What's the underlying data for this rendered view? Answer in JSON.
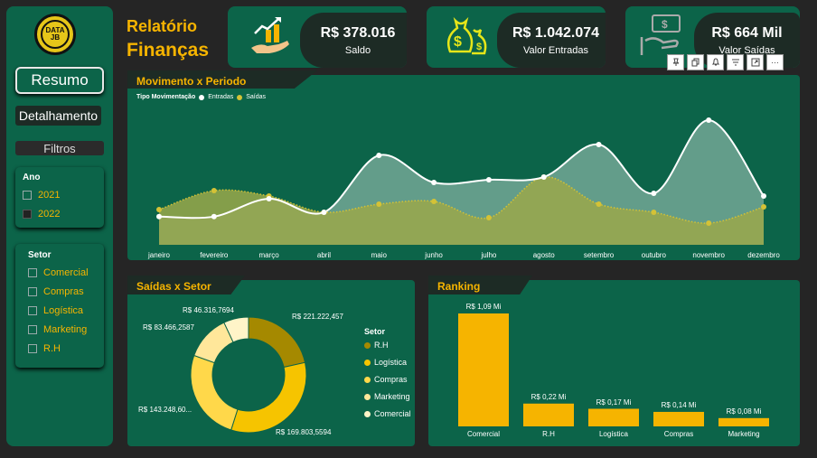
{
  "sidebar": {
    "logo_text": "DATA JB",
    "resumo_label": "Resumo",
    "detalhamento_label": "Detalhamento",
    "filtros_label": "Filtros",
    "ano": {
      "title": "Ano",
      "options": [
        {
          "label": "2021",
          "checked": false
        },
        {
          "label": "2022",
          "checked": true
        }
      ]
    },
    "setor": {
      "title": "Setor",
      "options": [
        {
          "label": "Comercial"
        },
        {
          "label": "Compras"
        },
        {
          "label": "Logística"
        },
        {
          "label": "Marketing"
        },
        {
          "label": "R.H"
        }
      ]
    }
  },
  "header": {
    "title_line1": "Relatório",
    "title_line2": "Finanças"
  },
  "kpis": [
    {
      "value": "R$ 378.016",
      "label": "Saldo",
      "icon": "growth-chart-hand-icon"
    },
    {
      "value": "R$ 1.042.074",
      "label": "Valor Entradas",
      "icon": "money-bags-icon"
    },
    {
      "value": "R$ 664 Mil",
      "label": "Valor Saídas",
      "icon": "payment-hand-icon"
    }
  ],
  "toolbar": [
    "pin-icon",
    "copy-icon",
    "bell-icon",
    "filter-icon",
    "focus-icon",
    "more-icon"
  ],
  "toolbar_more": "···",
  "colors": {
    "bg": "#252525",
    "panel": "#0c6449",
    "accent": "#f6b400",
    "dark": "#1d2b25",
    "entradas": "#ffffff",
    "saidas": "#d4c236"
  },
  "movimento": {
    "title": "Movimento x Periodo",
    "legend_title": "Tipo Movimentação",
    "legend": [
      "Entradas",
      "Saídas"
    ]
  },
  "saidas_setor": {
    "title": "Saídas x Setor",
    "legend_title": "Setor",
    "legend_items": [
      "R.H",
      "Logística",
      "Compras",
      "Marketing",
      "Comercial"
    ],
    "labels": [
      "R$ 221.222,457",
      "R$ 169.803,5594",
      "R$ 143.248,60...",
      "R$ 83.466,2587",
      "R$ 46.316,7694"
    ]
  },
  "ranking": {
    "title": "Ranking",
    "bars": [
      {
        "category": "Comercial",
        "label": "R$ 1,09 Mi",
        "value": 1.09
      },
      {
        "category": "R.H",
        "label": "R$ 0,22 Mi",
        "value": 0.22
      },
      {
        "category": "Logística",
        "label": "R$ 0,17 Mi",
        "value": 0.17
      },
      {
        "category": "Compras",
        "label": "R$ 0,14 Mi",
        "value": 0.14
      },
      {
        "category": "Marketing",
        "label": "R$ 0,08 Mi",
        "value": 0.08
      }
    ]
  },
  "chart_data": [
    {
      "type": "area",
      "title": "Movimento x Periodo",
      "categories": [
        "janeiro",
        "fevereiro",
        "março",
        "abril",
        "maio",
        "junho",
        "julho",
        "agosto",
        "setembro",
        "outubro",
        "novembro",
        "dezembro"
      ],
      "series": [
        {
          "name": "Entradas",
          "values": [
            52,
            52,
            85,
            60,
            165,
            115,
            120,
            125,
            185,
            95,
            230,
            90
          ]
        },
        {
          "name": "Saídas",
          "values": [
            65,
            100,
            90,
            60,
            75,
            80,
            50,
            125,
            75,
            60,
            40,
            70
          ]
        }
      ]
    },
    {
      "type": "pie",
      "title": "Saídas x Setor",
      "categories": [
        "Logística",
        "Compras",
        "R.H",
        "Marketing",
        "Comercial"
      ],
      "values": [
        221222.457,
        169803.5594,
        143248.6,
        83466.2587,
        46316.7694
      ]
    },
    {
      "type": "bar",
      "title": "Ranking",
      "categories": [
        "Comercial",
        "R.H",
        "Logística",
        "Compras",
        "Marketing"
      ],
      "values": [
        1.09,
        0.22,
        0.17,
        0.14,
        0.08
      ]
    }
  ]
}
